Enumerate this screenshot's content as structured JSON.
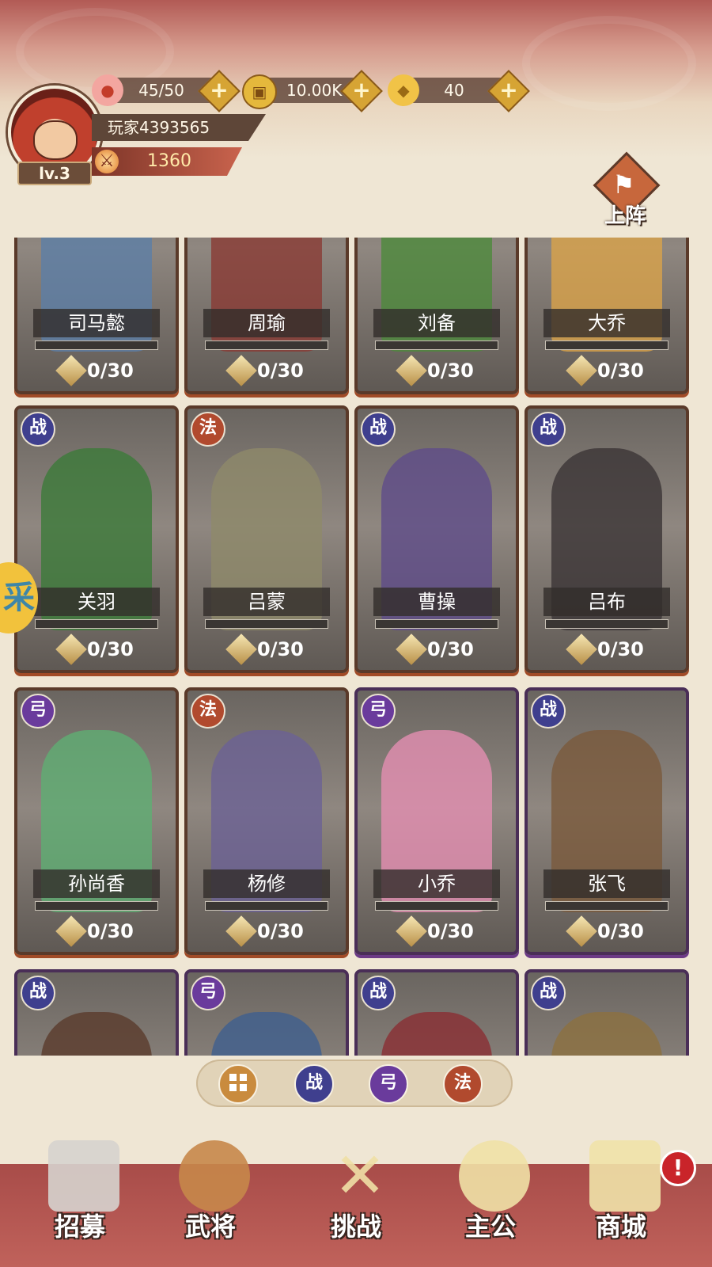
{
  "header": {
    "level": "lv.3",
    "player_name": "玩家4393565",
    "power": "1360",
    "resources": [
      {
        "name": "stamina",
        "icon": "peach-icon",
        "value": "45/50"
      },
      {
        "name": "coins",
        "icon": "coin-icon",
        "value": "10.00K"
      },
      {
        "name": "ingots",
        "icon": "gold-ingot-icon",
        "value": "40"
      }
    ],
    "deploy_label": "上阵"
  },
  "cards": [
    {
      "name": "司马懿",
      "count": "0/30",
      "class": "",
      "frame": "brown"
    },
    {
      "name": "周瑜",
      "count": "0/30",
      "class": "",
      "frame": "brown"
    },
    {
      "name": "刘备",
      "count": "0/30",
      "class": "",
      "frame": "brown"
    },
    {
      "name": "大乔",
      "count": "0/30",
      "class": "",
      "frame": "brown"
    },
    {
      "name": "关羽",
      "count": "0/30",
      "class": "战",
      "frame": "brown"
    },
    {
      "name": "吕蒙",
      "count": "0/30",
      "class": "法",
      "frame": "brown"
    },
    {
      "name": "曹操",
      "count": "0/30",
      "class": "战",
      "frame": "brown"
    },
    {
      "name": "吕布",
      "count": "0/30",
      "class": "战",
      "frame": "brown"
    },
    {
      "name": "孙尚香",
      "count": "0/30",
      "class": "弓",
      "frame": "brown"
    },
    {
      "name": "杨修",
      "count": "0/30",
      "class": "法",
      "frame": "brown"
    },
    {
      "name": "小乔",
      "count": "0/30",
      "class": "弓",
      "frame": "purple"
    },
    {
      "name": "张飞",
      "count": "0/30",
      "class": "战",
      "frame": "purple"
    },
    {
      "name": "",
      "count": "",
      "class": "战",
      "frame": "purple"
    },
    {
      "name": "",
      "count": "",
      "class": "弓",
      "frame": "purple"
    },
    {
      "name": "",
      "count": "",
      "class": "战",
      "frame": "purple"
    },
    {
      "name": "",
      "count": "",
      "class": "战",
      "frame": "purple"
    }
  ],
  "filters": [
    "战",
    "弓",
    "法"
  ],
  "nav": [
    {
      "label": "招募",
      "name": "nav-recruit",
      "icon": "scroll-icon"
    },
    {
      "label": "武将",
      "name": "nav-generals",
      "icon": "general-portrait-icon"
    },
    {
      "label": "挑战",
      "name": "nav-challenge",
      "icon": "crossed-swords-icon"
    },
    {
      "label": "主公",
      "name": "nav-lord",
      "icon": "lord-portrait-icon"
    },
    {
      "label": "商城",
      "name": "nav-shop",
      "icon": "shop-building-icon"
    }
  ],
  "side_bubble_text": "采",
  "alert_text": "!",
  "colors": {
    "banner": "#b25a55",
    "accent_gold": "#d6a434",
    "nav_band": "#a84c49"
  }
}
